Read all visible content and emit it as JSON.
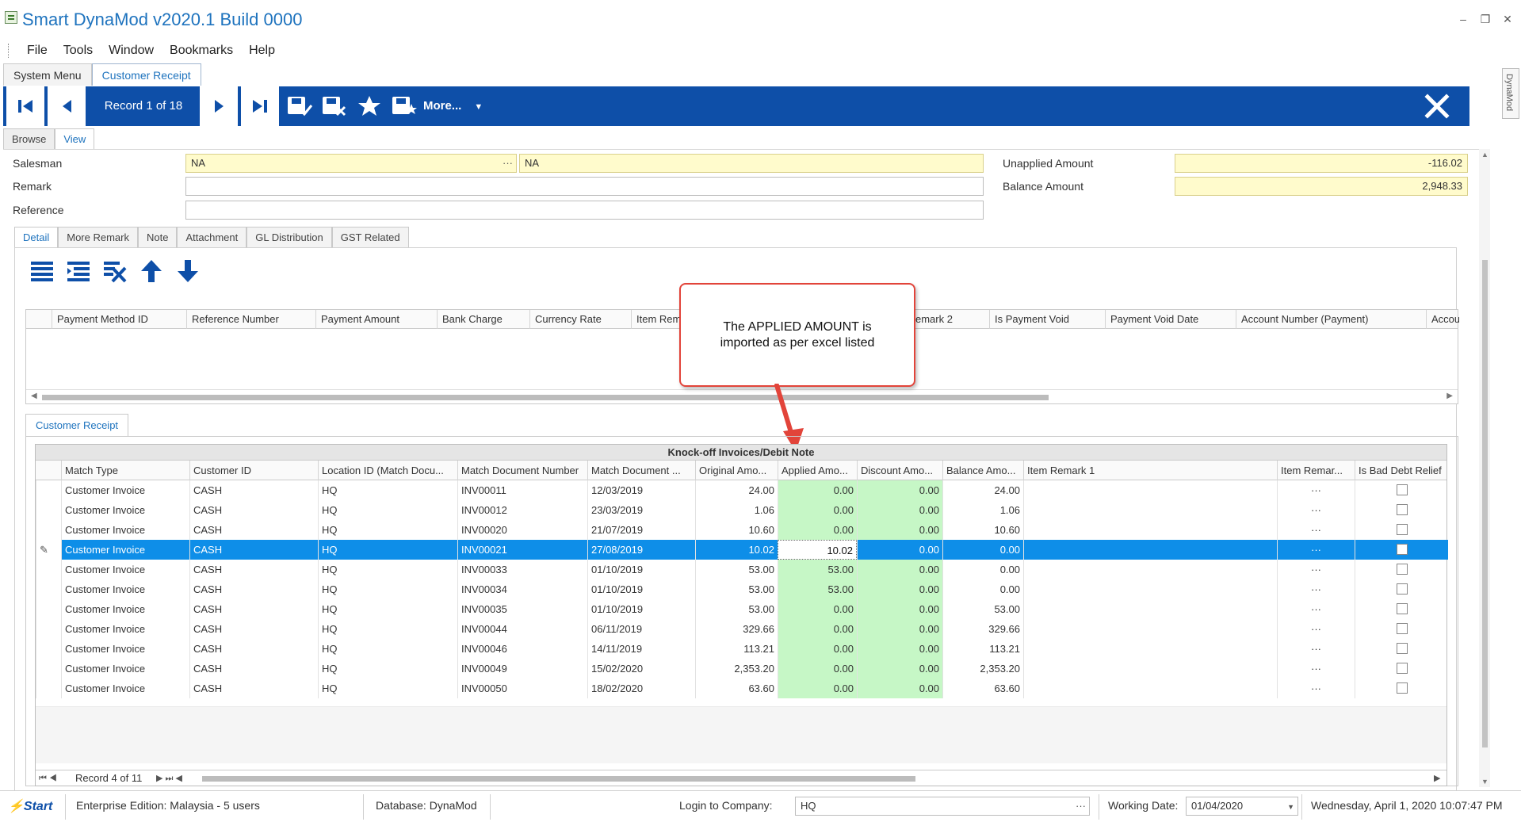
{
  "app": {
    "title": "Smart DynaMod v2020.1 Build 0000"
  },
  "menu": [
    "File",
    "Tools",
    "Window",
    "Bookmarks",
    "Help"
  ],
  "doc_tabs": [
    "System Menu",
    "Customer Receipt"
  ],
  "toolbar": {
    "record_label": "Record 1 of 18",
    "more_label": "More..."
  },
  "side_tab": "DynaMod",
  "view_tabs": [
    "Browse",
    "View"
  ],
  "fields": {
    "salesman_label": "Salesman",
    "salesman_code": "NA",
    "salesman_name": "NA",
    "remark_label": "Remark",
    "reference_label": "Reference",
    "unapplied_label": "Unapplied Amount",
    "unapplied_value": "-116.02",
    "balance_label": "Balance Amount",
    "balance_value": "2,948.33"
  },
  "detail_tabs": [
    "Detail",
    "More Remark",
    "Note",
    "Attachment",
    "GL Distribution",
    "GST Related"
  ],
  "payment_columns": [
    "Payment Method ID",
    "Reference Number",
    "Payment Amount",
    "Bank Charge",
    "Currency Rate",
    "Item Rem",
    "emark 2",
    "Is Payment Void",
    "Payment Void Date",
    "Account Number (Payment)",
    "Accoun"
  ],
  "callout": {
    "line1": "The APPLIED AMOUNT is",
    "line2": "imported as per excel listed"
  },
  "receipt_tab": "Customer Receipt",
  "grid": {
    "title": "Knock-off Invoices/Debit Note",
    "columns": [
      "Match Type",
      "Customer ID",
      "Location ID (Match Docu...",
      "Match Document Number",
      "Match Document ...",
      "Original Amo...",
      "Applied Amo...",
      "Discount Amo...",
      "Balance Amo...",
      "Item Remark 1",
      "Item Remar...",
      "Is Bad Debt Relief"
    ],
    "rows": [
      [
        "Customer Invoice",
        "CASH",
        "HQ",
        "INV00011",
        "12/03/2019",
        "24.00",
        "0.00",
        "0.00",
        "24.00"
      ],
      [
        "Customer Invoice",
        "CASH",
        "HQ",
        "INV00012",
        "23/03/2019",
        "1.06",
        "0.00",
        "0.00",
        "1.06"
      ],
      [
        "Customer Invoice",
        "CASH",
        "HQ",
        "INV00020",
        "21/07/2019",
        "10.60",
        "0.00",
        "0.00",
        "10.60"
      ],
      [
        "Customer Invoice",
        "CASH",
        "HQ",
        "INV00021",
        "27/08/2019",
        "10.02",
        "10.02",
        "0.00",
        "0.00"
      ],
      [
        "Customer Invoice",
        "CASH",
        "HQ",
        "INV00033",
        "01/10/2019",
        "53.00",
        "53.00",
        "0.00",
        "0.00"
      ],
      [
        "Customer Invoice",
        "CASH",
        "HQ",
        "INV00034",
        "01/10/2019",
        "53.00",
        "53.00",
        "0.00",
        "0.00"
      ],
      [
        "Customer Invoice",
        "CASH",
        "HQ",
        "INV00035",
        "01/10/2019",
        "53.00",
        "0.00",
        "0.00",
        "53.00"
      ],
      [
        "Customer Invoice",
        "CASH",
        "HQ",
        "INV00044",
        "06/11/2019",
        "329.66",
        "0.00",
        "0.00",
        "329.66"
      ],
      [
        "Customer Invoice",
        "CASH",
        "HQ",
        "INV00046",
        "14/11/2019",
        "113.21",
        "0.00",
        "0.00",
        "113.21"
      ],
      [
        "Customer Invoice",
        "CASH",
        "HQ",
        "INV00049",
        "15/02/2020",
        "2,353.20",
        "0.00",
        "0.00",
        "2,353.20"
      ],
      [
        "Customer Invoice",
        "CASH",
        "HQ",
        "INV00050",
        "18/02/2020",
        "63.60",
        "0.00",
        "0.00",
        "63.60"
      ]
    ],
    "ellipsis": "···",
    "footer_record": "Record 4 of 11"
  },
  "status": {
    "start": "Start",
    "edition": "Enterprise Edition: Malaysia - 5 users",
    "database": "Database: DynaMod",
    "login_label": "Login to Company:",
    "login_value": "HQ",
    "working_label": "Working Date:",
    "working_value": "01/04/2020",
    "datetime": "Wednesday, April 1, 2020 10:07:47 PM"
  },
  "colors": {
    "toolbar_blue": "#0e4fa8",
    "selection_blue": "#0e8ee8",
    "applied_green": "#c6f7c6",
    "callout_red": "#e2443a"
  }
}
